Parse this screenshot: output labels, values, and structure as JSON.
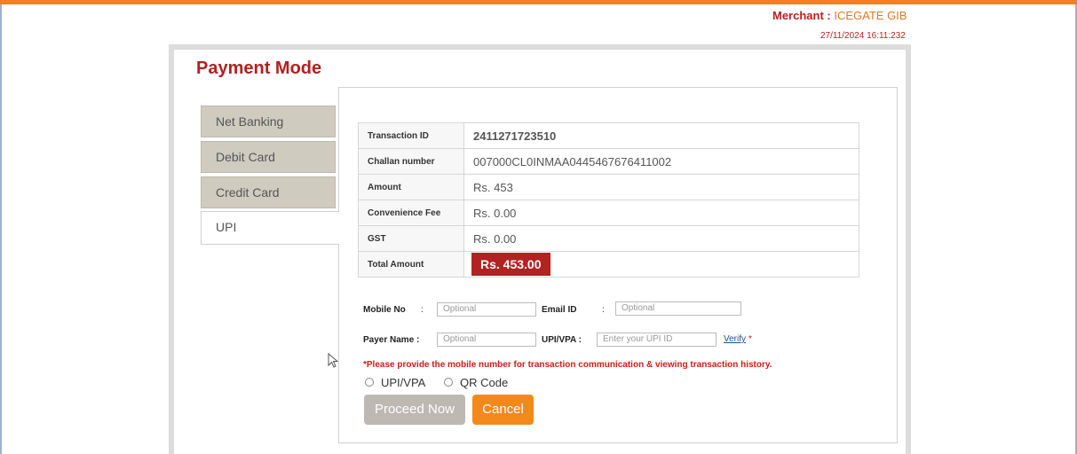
{
  "header": {
    "merchant_label": "Merchant :",
    "merchant_name": "ICEGATE GIB",
    "datetime": "27/11/2024 16:11:232"
  },
  "page": {
    "title": "Payment Mode"
  },
  "tabs": [
    {
      "label": "Net Banking",
      "active": false
    },
    {
      "label": "Debit Card",
      "active": false
    },
    {
      "label": "Credit Card",
      "active": false
    },
    {
      "label": "UPI",
      "active": true
    }
  ],
  "details": [
    {
      "label": "Transaction ID",
      "value": "2411271723510"
    },
    {
      "label": "Challan number",
      "value": "007000CL0INMAA0445467676411002"
    },
    {
      "label": "Amount",
      "value": "Rs. 453"
    },
    {
      "label": "Convenience Fee",
      "value": "Rs. 0.00"
    },
    {
      "label": "GST",
      "value": "Rs. 0.00"
    },
    {
      "label": "Total Amount",
      "value": "Rs. 453.00"
    }
  ],
  "form": {
    "mobile_label": "Mobile No",
    "mobile_placeholder": "Optional",
    "email_label": "Email ID",
    "email_placeholder": "Optional",
    "payer_label": "Payer Name :",
    "payer_placeholder": "Optional",
    "upi_label": "UPI/VPA :",
    "upi_placeholder": "Enter your UPI ID",
    "verify_label": "Verify",
    "required_mark": "*",
    "colon": ":",
    "note": "*Please provide the mobile number for transaction communication & viewing transaction history.",
    "radio_upi": "UPI/VPA",
    "radio_qr": "QR Code"
  },
  "buttons": {
    "proceed": "Proceed Now",
    "cancel": "Cancel"
  },
  "colors": {
    "accent_orange": "#f07f2a",
    "title_red": "#b31f1f",
    "total_badge": "#b22222"
  }
}
